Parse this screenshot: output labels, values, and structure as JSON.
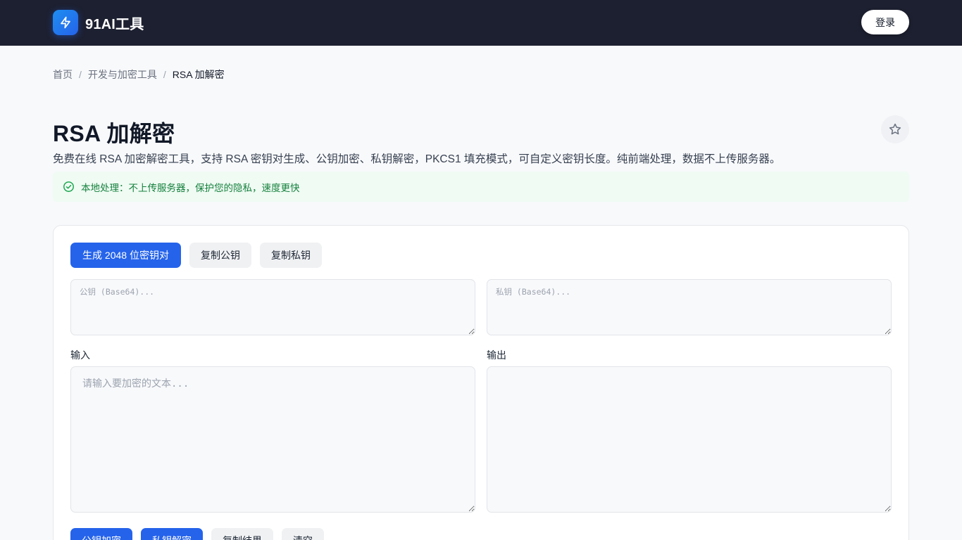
{
  "header": {
    "brand": "91AI工具",
    "login_label": "登录"
  },
  "breadcrumb": {
    "home": "首页",
    "category": "开发与加密工具",
    "current": "RSA 加解密",
    "separator": "/"
  },
  "page": {
    "title": "RSA 加解密",
    "description": "免费在线 RSA 加密解密工具，支持 RSA 密钥对生成、公钥加密、私钥解密，PKCS1 填充模式，可自定义密钥长度。纯前端处理，数据不上传服务器。",
    "notice": "本地处理：不上传服务器，保护您的隐私，速度更快"
  },
  "tool": {
    "generate_label": "生成 2048 位密钥对",
    "copy_public_label": "复制公钥",
    "copy_private_label": "复制私钥",
    "public_key": {
      "value": "",
      "placeholder": "公钥 (Base64)..."
    },
    "private_key": {
      "value": "",
      "placeholder": "私钥 (Base64)..."
    },
    "input_label": "输入",
    "input": {
      "value": "",
      "placeholder": "请输入要加密的文本..."
    },
    "output_label": "输出",
    "output": {
      "value": ""
    },
    "encrypt_label": "公钥加密",
    "decrypt_label": "私钥解密",
    "copy_result_label": "复制结果",
    "clear_label": "清空"
  },
  "icons": {
    "logo": "bolt-icon",
    "favorite": "star-icon",
    "notice": "check-circle-icon"
  },
  "colors": {
    "header_bg": "#1d2030",
    "primary": "#2563eb",
    "notice_bg": "#effbf3",
    "notice_text": "#15803d"
  }
}
